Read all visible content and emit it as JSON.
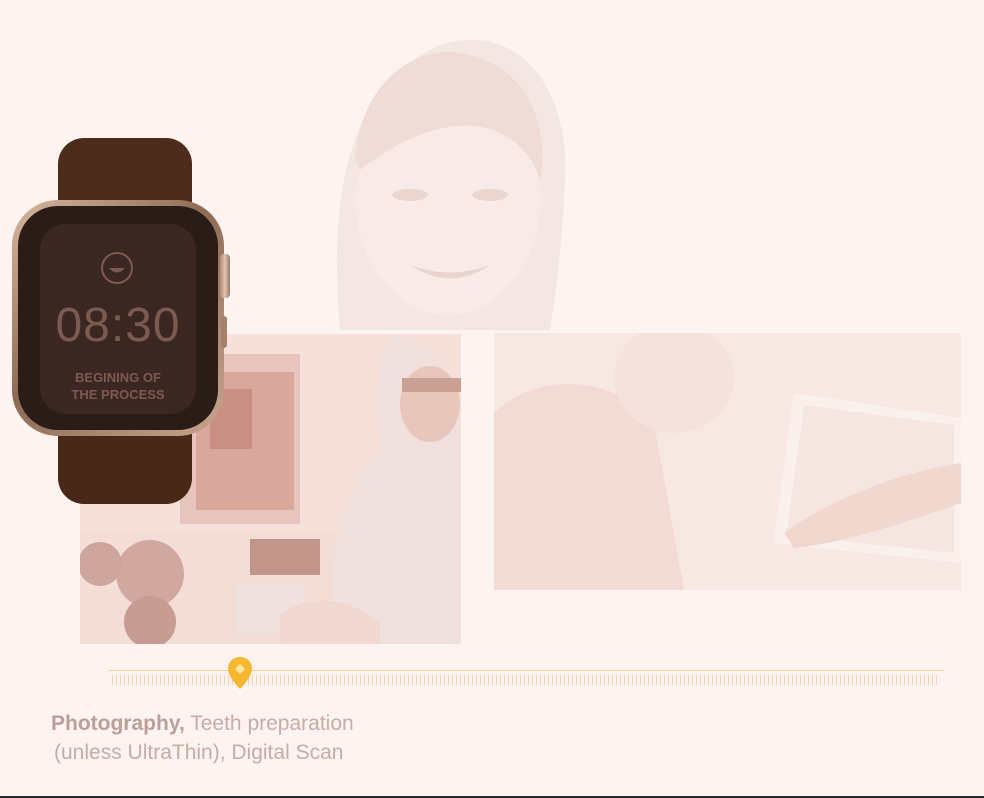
{
  "watch": {
    "time": "08:30",
    "caption_line1": "BEGINING OF",
    "caption_line2": "THE PROCESS",
    "icon": "smile-face-icon"
  },
  "timeline": {
    "marker_icon": "location-pin-icon",
    "marker_position_fraction": 0.155
  },
  "caption": {
    "bold": "Photography,",
    "line1_rest": " Teeth preparation",
    "line2": "(unless UltraThin), Digital Scan"
  },
  "colors": {
    "background": "#fdf3f0",
    "accent": "#f5b82e",
    "watch_band": "#4e2c1b",
    "caption_text": "#c7aca4"
  }
}
